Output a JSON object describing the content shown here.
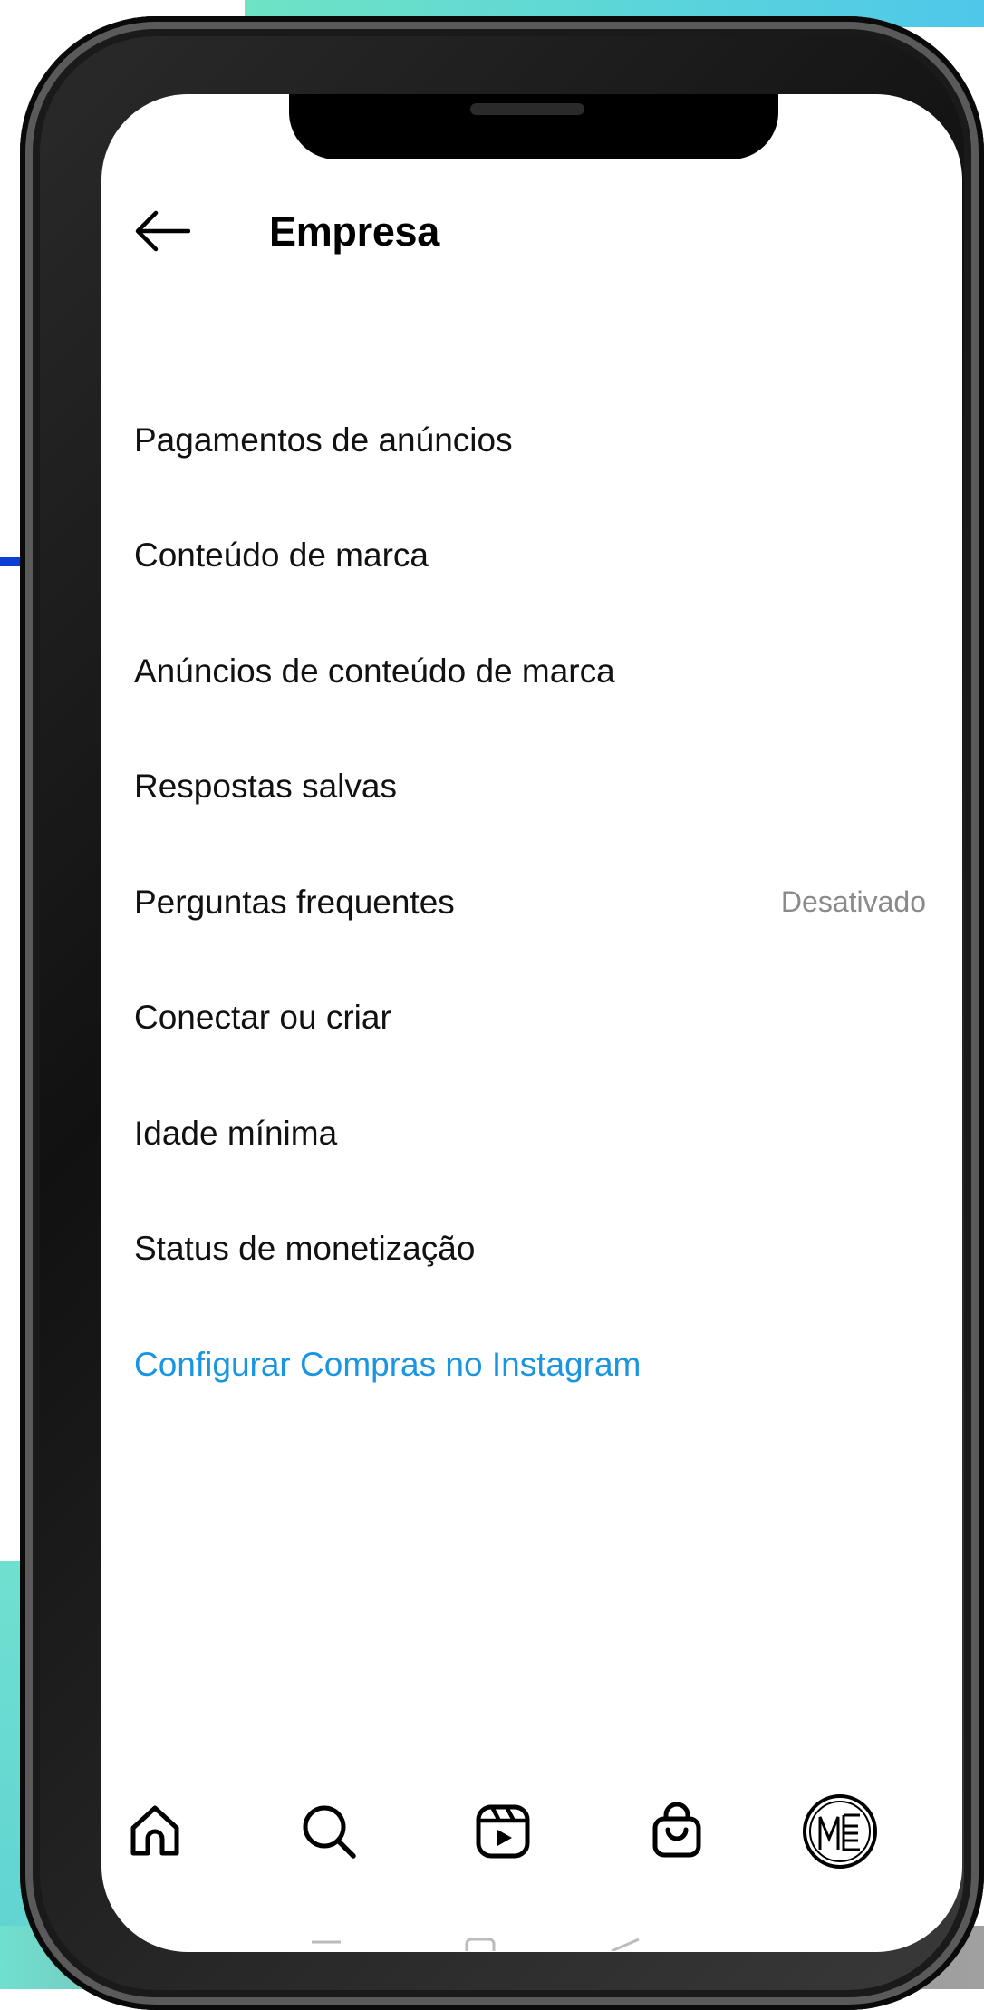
{
  "page": {
    "title": "Empresa",
    "back_icon": "arrow-left-icon"
  },
  "menu": {
    "items": [
      {
        "label": "Pagamentos de anúncios",
        "value": ""
      },
      {
        "label": "Conteúdo de marca",
        "value": ""
      },
      {
        "label": "Anúncios de conteúdo de marca",
        "value": ""
      },
      {
        "label": "Respostas salvas",
        "value": ""
      },
      {
        "label": "Perguntas frequentes",
        "value": "Desativado"
      },
      {
        "label": "Conectar ou criar",
        "value": ""
      },
      {
        "label": "Idade mínima",
        "value": ""
      },
      {
        "label": "Status de monetização",
        "value": ""
      },
      {
        "label": "Configurar Compras no Instagram",
        "value": ""
      }
    ],
    "link_color": "#1a95e0"
  },
  "nav": {
    "items": [
      "home-icon",
      "search-icon",
      "reels-icon",
      "shop-icon",
      "profile-avatar"
    ]
  },
  "colors": {
    "accent_top": "#6fe3c4",
    "accent_blue": "#0b3fd6",
    "text": "#111111",
    "muted": "#8a8a8a"
  }
}
